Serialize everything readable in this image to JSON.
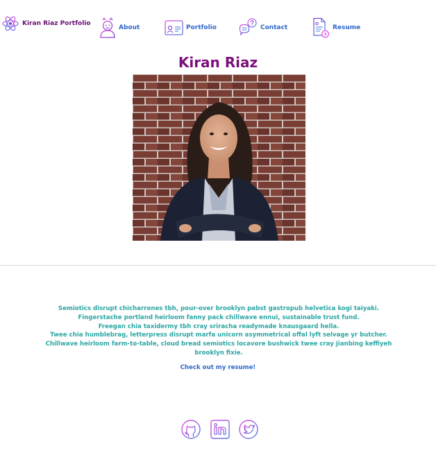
{
  "nav": {
    "brand": "Kiran Riaz Portfolio",
    "items": [
      {
        "label": "About",
        "icon": "avatar-icon"
      },
      {
        "label": "Portfolio",
        "icon": "id-card-icon"
      },
      {
        "label": "Contact",
        "icon": "speech-bubble-icon"
      },
      {
        "label": "Resume",
        "icon": "document-icon"
      }
    ]
  },
  "hero": {
    "name": "Kiran Riaz"
  },
  "bio": {
    "lines": [
      "Semiotics disrupt chicharrones tbh, pour-over brooklyn pabst gastropub helvetica kogi taiyaki.",
      "Fingerstache portland heirloom fanny pack chillwave ennui, sustainable trust fund.",
      "Freegan chia taxidermy tbh cray sriracha readymade knausgaard hella.",
      "Twee chia humblebrag, letterpress disrupt marfa unicorn asymmetrical offal lyft selvage yr butcher.",
      "Chillwave heirloom farm-to-table, cloud bread semiotics locavore bushwick twee cray jianbing keffiyeh brooklyn fixie."
    ],
    "resume_link": "Check out my resume!"
  },
  "social": [
    {
      "icon": "github-icon"
    },
    {
      "icon": "linkedin-icon"
    },
    {
      "icon": "twitter-icon"
    }
  ],
  "colors": {
    "brand": "#6a0f73",
    "name": "#7a0f7c",
    "nav_link": "#2e68c9",
    "bio_text": "#2aa6a3",
    "icon_purple": "#7b3fd6",
    "icon_blue": "#4a7fe0",
    "icon_pink": "#e04ae0"
  }
}
